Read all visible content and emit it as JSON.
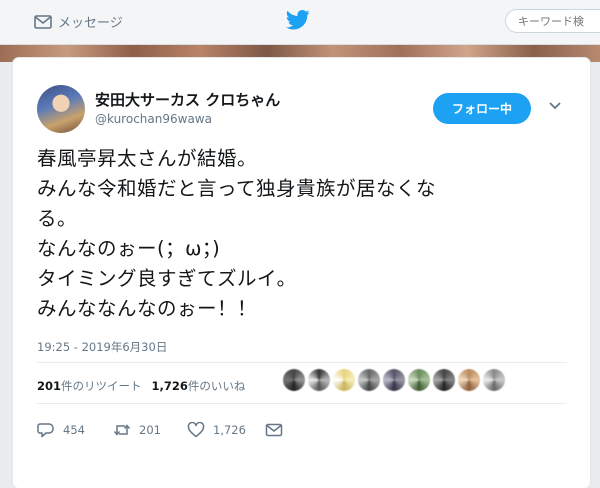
{
  "nav": {
    "messages_label": "メッセージ",
    "search_placeholder": "キーワード検"
  },
  "tweet": {
    "display_name": "安田大サーカス クロちゃん",
    "handle": "@kurochan96wawa",
    "follow_label": "フォロー中",
    "text_lines": [
      "春風亭昇太さんが結婚。",
      "みんな令和婚だと言って独身貴族が居なくな",
      "る。",
      "なんなのぉー(；ω；)",
      "タイミング良すぎてズルイ。",
      "みんななんなのぉー！！"
    ],
    "timestamp": "19:25 - 2019年6月30日",
    "retweet_count": "201",
    "retweet_label": "件のリツイート",
    "like_count": "1,726",
    "like_label": "件のいいね",
    "reply_action_count": "454",
    "retweet_action_count": "201",
    "like_action_count": "1,726"
  },
  "colors": {
    "brand": "#1da1f2",
    "text": "#14171a",
    "muted": "#657786"
  },
  "icons": {
    "messages": "envelope-icon",
    "logo": "twitter-bird-icon",
    "menu": "chevron-down-icon",
    "reply": "reply-icon",
    "retweet": "retweet-icon",
    "like": "heart-icon",
    "dm": "envelope-icon"
  }
}
